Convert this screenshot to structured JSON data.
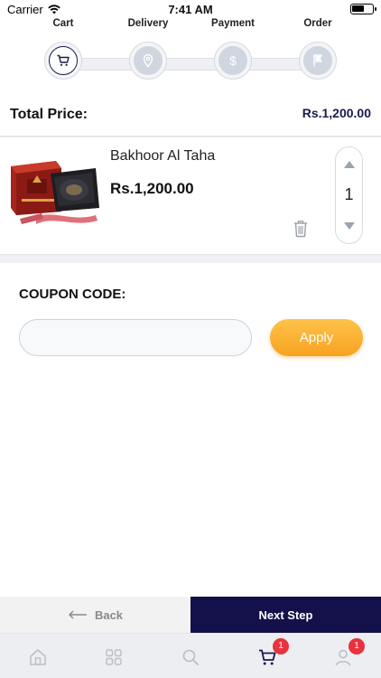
{
  "status_bar": {
    "carrier": "Carrier",
    "time": "7:41 AM"
  },
  "steps": [
    {
      "label": "Cart",
      "icon": "cart-icon",
      "active": true
    },
    {
      "label": "Delivery",
      "icon": "location-pin-icon",
      "active": false
    },
    {
      "label": "Payment",
      "icon": "dollar-icon",
      "active": false
    },
    {
      "label": "Order",
      "icon": "flag-icon",
      "active": false
    }
  ],
  "summary": {
    "total_label": "Total Price:",
    "total_value": "Rs.1,200.00"
  },
  "cart_item": {
    "name": "Bakhoor Al Taha",
    "price": "Rs.1,200.00",
    "quantity": "1",
    "image_icon": "product-image"
  },
  "coupon": {
    "label": "COUPON CODE:",
    "input_value": "",
    "placeholder": "",
    "apply_label": "Apply"
  },
  "actions": {
    "back_label": "Back",
    "next_label": "Next Step"
  },
  "tab_bar": {
    "items": [
      {
        "icon": "home-icon"
      },
      {
        "icon": "grid-icon"
      },
      {
        "icon": "search-icon"
      },
      {
        "icon": "cart-icon",
        "badge": "1",
        "active": true
      },
      {
        "icon": "user-icon",
        "badge": "1"
      }
    ]
  },
  "colors": {
    "brand_navy": "#14104a",
    "accent_orange": "#f7a21f",
    "badge_red": "#e8323c",
    "inactive_step": "#cfd6df"
  }
}
